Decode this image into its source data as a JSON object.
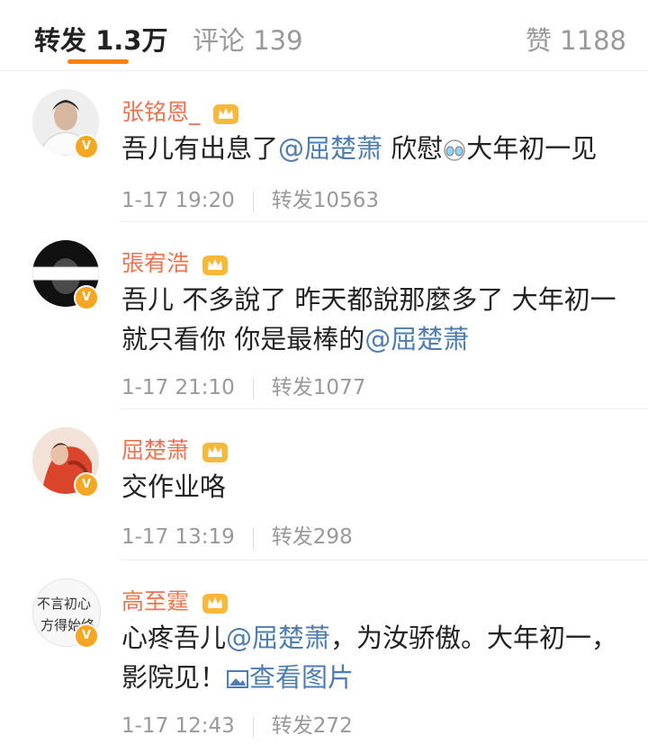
{
  "tabs": {
    "reposts": "转发 1.3万",
    "comments": "评论 139",
    "likes": "赞 1188"
  },
  "items": [
    {
      "name": "张铭恩_",
      "text_before": "吾儿有出息了",
      "mention": "@屈楚萧",
      "text_mid": " 欣慰",
      "emoji": "tears-of-joy-icon",
      "text_after": "大年初一见",
      "time": "1-17 19:20",
      "reposts": "转发10563"
    },
    {
      "name": "張宥浩",
      "text_before": "吾儿 不多說了 昨天都說那麼多了 大年初一就只看你 你是最棒的",
      "mention": "@屈楚萧",
      "time": "1-17 21:10",
      "reposts": "转发1077"
    },
    {
      "name": "屈楚萧",
      "text_before": "交作业咯",
      "time": "1-17 13:19",
      "reposts": "转发298"
    },
    {
      "name": "高至霆",
      "text_before": "心疼吾儿",
      "mention": "@屈楚萧",
      "text_after": "，为汝骄傲。大年初一，影院见！",
      "link_icon": "image-icon",
      "link": "查看图片",
      "time": "1-17 12:43",
      "reposts": "转发272",
      "avatar_text": [
        "不言初心",
        "方得始终"
      ]
    }
  ],
  "colors": {
    "accent": "#ff8200",
    "username": "#eb7350",
    "link": "#507daf",
    "verified_badge": "#f5a623"
  }
}
